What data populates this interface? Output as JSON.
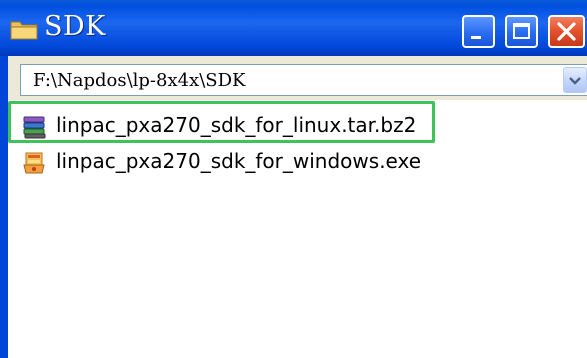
{
  "window": {
    "title": "SDK",
    "icon": "folder-icon",
    "controls": {
      "minimize": "minimize-icon",
      "maximize": "maximize-icon",
      "close": "close-icon"
    }
  },
  "address": {
    "path": "F:\\Napdos\\lp-8x4x\\SDK",
    "dropdown_icon": "chevron-down-icon"
  },
  "files": [
    {
      "name": "linpac_pxa270_sdk_for_linux.tar.bz2",
      "icon": "archive-icon",
      "highlighted": true
    },
    {
      "name": "linpac_pxa270_sdk_for_windows.exe",
      "icon": "installer-icon",
      "highlighted": false
    }
  ],
  "colors": {
    "titlebar": "#0a5ad8",
    "highlight": "#3cc35a",
    "close_button": "#e4502c"
  }
}
